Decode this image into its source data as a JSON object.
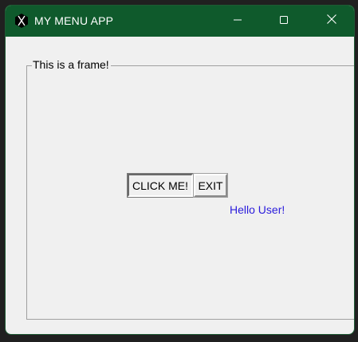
{
  "window": {
    "title": "MY MENU APP",
    "titlebar_color": "#0f5a2c",
    "app_icon": "logo-icon",
    "controls": {
      "minimize_icon": "minimize-icon",
      "maximize_icon": "maximize-icon",
      "close_icon": "close-icon"
    }
  },
  "frame": {
    "label": "This is a frame!"
  },
  "buttons": {
    "click_label": "CLICK ME!",
    "exit_label": "EXIT"
  },
  "greeting": {
    "text": "Hello User!",
    "color": "#2a1bdc"
  }
}
